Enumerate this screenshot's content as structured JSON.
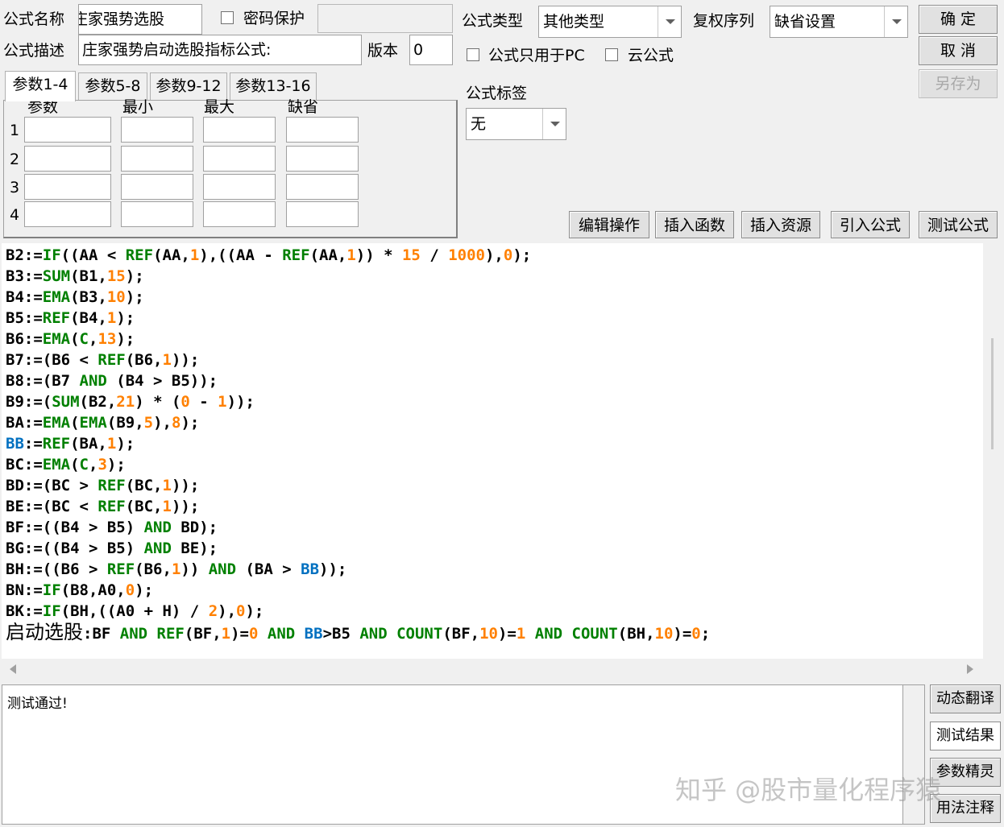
{
  "header": {
    "name_label": "公式名称",
    "name_value": "庄家强势选股",
    "password_label": "密码保护",
    "password_value": "",
    "desc_label": "公式描述",
    "desc_value": "庄家强势启动选股指标公式:",
    "version_label": "版本",
    "version_value": "0",
    "type_label": "公式类型",
    "type_value": "其他类型",
    "rights_label": "复权序列",
    "rights_value": "缺省设置",
    "pc_only_label": "公式只用于PC",
    "cloud_label": "云公式",
    "tag_label": "公式标签",
    "tag_value": "无"
  },
  "buttons": {
    "ok": "确 定",
    "cancel": "取 消",
    "save_as": "另存为",
    "edit_ops": "编辑操作",
    "insert_func": "插入函数",
    "insert_res": "插入资源",
    "import_formula": "引入公式",
    "test_formula": "测试公式"
  },
  "params": {
    "tabs": [
      "参数1-4",
      "参数5-8",
      "参数9-12",
      "参数13-16"
    ],
    "columns": [
      "参数",
      "最小",
      "最大",
      "缺省"
    ],
    "rows": [
      "1",
      "2",
      "3",
      "4"
    ]
  },
  "code_colors": {
    "text": "#000000",
    "func": "#008000",
    "num": "#ff8000",
    "var": "#0070c0"
  },
  "code_lines": [
    [
      [
        "B2:=",
        "t"
      ],
      [
        "IF",
        "f"
      ],
      [
        "((AA < ",
        "t"
      ],
      [
        "REF",
        "f"
      ],
      [
        "(AA,",
        "t"
      ],
      [
        "1",
        "n"
      ],
      [
        "),((AA - ",
        "t"
      ],
      [
        "REF",
        "f"
      ],
      [
        "(AA,",
        "t"
      ],
      [
        "1",
        "n"
      ],
      [
        ")) * ",
        "t"
      ],
      [
        "15",
        "n"
      ],
      [
        " / ",
        "t"
      ],
      [
        "1000",
        "n"
      ],
      [
        "),",
        "t"
      ],
      [
        "0",
        "n"
      ],
      [
        ");",
        "t"
      ]
    ],
    [
      [
        "B3:=",
        "t"
      ],
      [
        "SUM",
        "f"
      ],
      [
        "(B1,",
        "t"
      ],
      [
        "15",
        "n"
      ],
      [
        ");",
        "t"
      ]
    ],
    [
      [
        "B4:=",
        "t"
      ],
      [
        "EMA",
        "f"
      ],
      [
        "(B3,",
        "t"
      ],
      [
        "10",
        "n"
      ],
      [
        ");",
        "t"
      ]
    ],
    [
      [
        "B5:=",
        "t"
      ],
      [
        "REF",
        "f"
      ],
      [
        "(B4,",
        "t"
      ],
      [
        "1",
        "n"
      ],
      [
        ");",
        "t"
      ]
    ],
    [
      [
        "B6:=",
        "t"
      ],
      [
        "EMA",
        "f"
      ],
      [
        "(",
        "t"
      ],
      [
        "C",
        "f"
      ],
      [
        ",",
        "t"
      ],
      [
        "13",
        "n"
      ],
      [
        ");",
        "t"
      ]
    ],
    [
      [
        "B7:=(B6 < ",
        "t"
      ],
      [
        "REF",
        "f"
      ],
      [
        "(B6,",
        "t"
      ],
      [
        "1",
        "n"
      ],
      [
        "));",
        "t"
      ]
    ],
    [
      [
        "B8:=(B7 ",
        "t"
      ],
      [
        "AND",
        "f"
      ],
      [
        " (B4 > B5));",
        "t"
      ]
    ],
    [
      [
        "B9:=(",
        "t"
      ],
      [
        "SUM",
        "f"
      ],
      [
        "(B2,",
        "t"
      ],
      [
        "21",
        "n"
      ],
      [
        ") * (",
        "t"
      ],
      [
        "0",
        "n"
      ],
      [
        " - ",
        "t"
      ],
      [
        "1",
        "n"
      ],
      [
        "));",
        "t"
      ]
    ],
    [
      [
        "BA:=",
        "t"
      ],
      [
        "EMA",
        "f"
      ],
      [
        "(",
        "t"
      ],
      [
        "EMA",
        "f"
      ],
      [
        "(B9,",
        "t"
      ],
      [
        "5",
        "n"
      ],
      [
        "),",
        "t"
      ],
      [
        "8",
        "n"
      ],
      [
        ");",
        "t"
      ]
    ],
    [
      [
        "BB",
        "v"
      ],
      [
        ":=",
        "t"
      ],
      [
        "REF",
        "f"
      ],
      [
        "(BA,",
        "t"
      ],
      [
        "1",
        "n"
      ],
      [
        ");",
        "t"
      ]
    ],
    [
      [
        "BC:=",
        "t"
      ],
      [
        "EMA",
        "f"
      ],
      [
        "(",
        "t"
      ],
      [
        "C",
        "f"
      ],
      [
        ",",
        "t"
      ],
      [
        "3",
        "n"
      ],
      [
        ");",
        "t"
      ]
    ],
    [
      [
        "BD:=(BC > ",
        "t"
      ],
      [
        "REF",
        "f"
      ],
      [
        "(BC,",
        "t"
      ],
      [
        "1",
        "n"
      ],
      [
        "));",
        "t"
      ]
    ],
    [
      [
        "BE:=(BC < ",
        "t"
      ],
      [
        "REF",
        "f"
      ],
      [
        "(BC,",
        "t"
      ],
      [
        "1",
        "n"
      ],
      [
        "));",
        "t"
      ]
    ],
    [
      [
        "BF:=((B4 > B5) ",
        "t"
      ],
      [
        "AND",
        "f"
      ],
      [
        " BD);",
        "t"
      ]
    ],
    [
      [
        "BG:=((B4 > B5) ",
        "t"
      ],
      [
        "AND",
        "f"
      ],
      [
        " BE);",
        "t"
      ]
    ],
    [
      [
        "BH:=((B6 > ",
        "t"
      ],
      [
        "REF",
        "f"
      ],
      [
        "(B6,",
        "t"
      ],
      [
        "1",
        "n"
      ],
      [
        ")) ",
        "t"
      ],
      [
        "AND",
        "f"
      ],
      [
        " (BA > ",
        "t"
      ],
      [
        "BB",
        "v"
      ],
      [
        "));",
        "t"
      ]
    ],
    [
      [
        "BN:=",
        "t"
      ],
      [
        "IF",
        "f"
      ],
      [
        "(B8,A0,",
        "t"
      ],
      [
        "0",
        "n"
      ],
      [
        ");",
        "t"
      ]
    ],
    [
      [
        "BK:=",
        "t"
      ],
      [
        "IF",
        "f"
      ],
      [
        "(BH,((A0 + H) / ",
        "t"
      ],
      [
        "2",
        "n"
      ],
      [
        "),",
        "t"
      ],
      [
        "0",
        "n"
      ],
      [
        ");",
        "t"
      ]
    ],
    [
      [
        "启动选股",
        "c"
      ],
      [
        ":BF ",
        "t"
      ],
      [
        "AND",
        "f"
      ],
      [
        " ",
        "t"
      ],
      [
        "REF",
        "f"
      ],
      [
        "(BF,",
        "t"
      ],
      [
        "1",
        "n"
      ],
      [
        ")=",
        "t"
      ],
      [
        "0",
        "n"
      ],
      [
        " ",
        "t"
      ],
      [
        "AND",
        "f"
      ],
      [
        " ",
        "t"
      ],
      [
        "BB",
        "v"
      ],
      [
        ">B5 ",
        "t"
      ],
      [
        "AND",
        "f"
      ],
      [
        " ",
        "t"
      ],
      [
        "COUNT",
        "f"
      ],
      [
        "(BF,",
        "t"
      ],
      [
        "10",
        "n"
      ],
      [
        ")=",
        "t"
      ],
      [
        "1",
        "n"
      ],
      [
        " ",
        "t"
      ],
      [
        "AND",
        "f"
      ],
      [
        " ",
        "t"
      ],
      [
        "COUNT",
        "f"
      ],
      [
        "(BH,",
        "t"
      ],
      [
        "10",
        "n"
      ],
      [
        ")=",
        "t"
      ],
      [
        "0",
        "n"
      ],
      [
        ";",
        "t"
      ]
    ]
  ],
  "result": {
    "text": "测试通过!",
    "side_buttons": [
      "动态翻译",
      "测试结果",
      "参数精灵",
      "用法注释"
    ]
  },
  "watermark": "知乎 @股市量化程序猿"
}
